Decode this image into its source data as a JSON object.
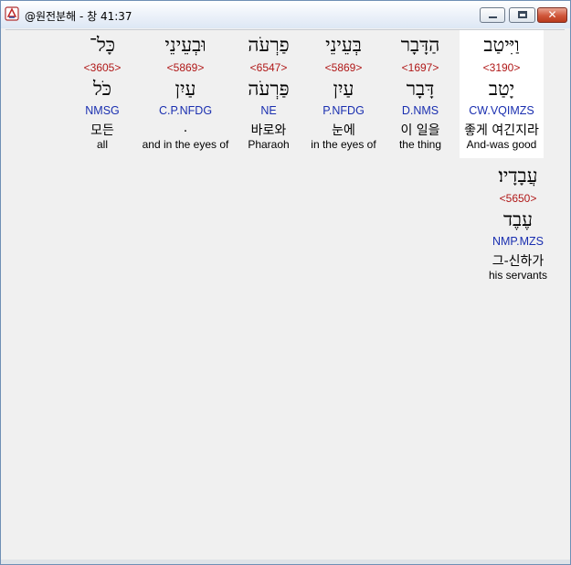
{
  "window": {
    "title": "@원전분해 - 창 41:37",
    "close_glyph": "✕"
  },
  "words": [
    {
      "hebrew": "וַיִּיטַב",
      "strong": "<3190>",
      "lexeme": "יָטַב",
      "morph": "CW.VQIMZS",
      "korean": "좋게 여긴지라",
      "english": "And-was good",
      "selected": true
    },
    {
      "hebrew": "הַדָּבָר",
      "strong": "<1697>",
      "lexeme": "דָּבָר",
      "morph": "D.NMS",
      "korean": "이 일을",
      "english": "the thing"
    },
    {
      "hebrew": "בְּעֵינֵי",
      "strong": "<5869>",
      "lexeme": "עַיִן",
      "morph": "P.NFDG",
      "korean": "눈에",
      "english": "in the eyes of"
    },
    {
      "hebrew": "פַרְעֹה",
      "strong": "<6547>",
      "lexeme": "פַּרְעֹה",
      "morph": "NE",
      "korean": "바로와",
      "english": "Pharaoh"
    },
    {
      "hebrew": "וּבְעֵינֵי",
      "strong": "<5869>",
      "lexeme": "עַיִן",
      "morph": "C.P.NFDG",
      "korean": ".",
      "english": "and in the eyes of"
    },
    {
      "hebrew": "כָּל־",
      "strong": "<3605>",
      "lexeme": "כֹּל",
      "morph": "NMSG",
      "korean": "모든",
      "english": "all"
    },
    {
      "hebrew": "עֲבָדָיו׃",
      "strong": "<5650>",
      "lexeme": "עֶבֶד",
      "morph": "NMP.MZS",
      "korean": "그-신하가",
      "english": "his servants"
    }
  ]
}
